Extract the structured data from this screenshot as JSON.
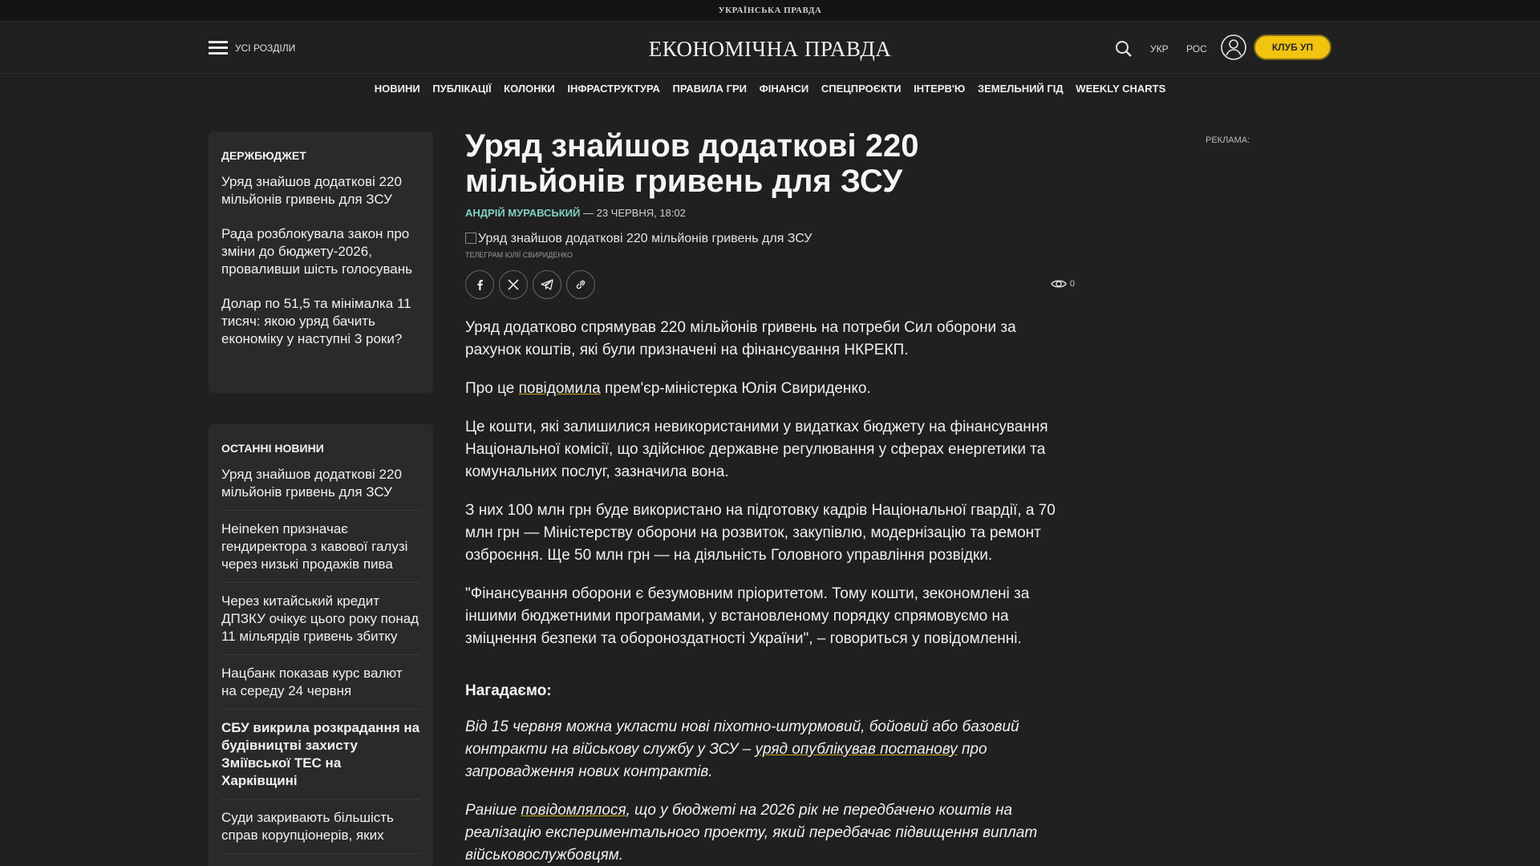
{
  "topstrip": {
    "title": "УКРАЇНСЬКА ПРАВДА"
  },
  "header": {
    "all_sections": "УСІ РОЗДІЛИ",
    "logo": "ЕКОНОМІЧНА ПРАВДА",
    "lang_ukr": "УКР",
    "lang_ros": "РОС",
    "club": "КЛУБ УП"
  },
  "nav": {
    "items": [
      "НОВИНИ",
      "ПУБЛІКАЦІЇ",
      "КОЛОНКИ",
      "ІНФРАСТРУКТУРА",
      "ПРАВИЛА ГРИ",
      "ФІНАНСИ",
      "СПЕЦПРОЄКТИ",
      "ІНТЕРВ'Ю",
      "ЗЕМЕЛЬНИЙ ГІД",
      "WEEKLY CHARTS"
    ]
  },
  "box1": {
    "title": "ДЕРЖБЮДЖЕТ",
    "links": [
      "Уряд знайшов додаткові 220 мільйонів гривень для ЗСУ",
      "Рада розблокувала закон про зміни до бюджету-2026, проваливши шість голосувань",
      "Долар по 51,5 та мінімалка 11 тисяч: якою уряд бачить економіку у наступні 3 роки?"
    ]
  },
  "box2": {
    "title": "ОСТАННІ НОВИНИ",
    "items": [
      "Уряд знайшов додаткові 220 мільйонів гривень для ЗСУ",
      "Heineken призначає гендиректора з кавової галузі через низькі продажів пива",
      "Через китайський кредит ДПЗКУ очікує цього року понад 11 мільярдів гривень збитку",
      "Нацбанк показав курс валют на середу 24 червня",
      "СБУ викрила розкрадання на будівництві захисту Зміївської ТЕС на Харківщині",
      "Суди закривають більшість справ корупціонерів, яких"
    ]
  },
  "article": {
    "title": "Уряд знайшов додаткові 220 мільйонів гривень для ЗСУ",
    "author": "АНДРІЙ МУРАВСЬКИЙ",
    "date": " — 23 ЧЕРВНЯ, 18:02",
    "image_alt": "Уряд знайшов додаткові 220 мільйонів гривень для ЗСУ",
    "caption": "ТЕЛЕГРАМ ЮЛІЇ СВИРИДЕНКО",
    "views": "0",
    "p1": "Уряд додатково спрямував 220 мільйонів гривень на потреби Сил оборони за рахунок коштів, які були призначені на фінансування НКРЕКП.",
    "p2_a": "Про це ",
    "p2_link": "повідомила",
    "p2_b": " прем'єр-міністерка Юлія Свириденко.",
    "p3": "Це кошти, які залишилися невикористаними у видатках бюджету на фінансування Національної комісії, що здійснює державне регулювання у сферах енергетики та комунальних послуг, зазначила вона.",
    "p4": "З них 100 млн грн буде використано на підготовку кадрів Національної гвардії, а 70 млн грн — Міністерству оборони на розвиток, закупівлю, модернізацію та ремонт озброєння. Ще 50 млн грн — на діяльність Головного управління розвідки.",
    "p5": "\"Фінансування оборони є безумовним пріоритетом. Тому кошти, зекономлені за іншими бюджетними програмами, у встановленому порядку спрямовуємо на зміцнення безпеки та обороноздатності України\", – говориться у повідомленні.",
    "remind": "Нагадаємо:",
    "p6_a": "Від 15 червня можна укласти нові піхотно-штурмовий, бойовий або базовий контракти на військову службу у ЗСУ – ",
    "p6_link": "уряд опублікував постанову",
    "p6_b": " про запровадження нових контрактів.",
    "p7_a": "Раніше ",
    "p7_link": "повідомлялося",
    "p7_b": ", що у бюджеті на 2026 рік не передбачено коштів на реалізацію експериментального проекту, який передбачає підвищення виплат військовослужбовцям."
  },
  "ad": {
    "label": "РЕКЛАМА:"
  }
}
